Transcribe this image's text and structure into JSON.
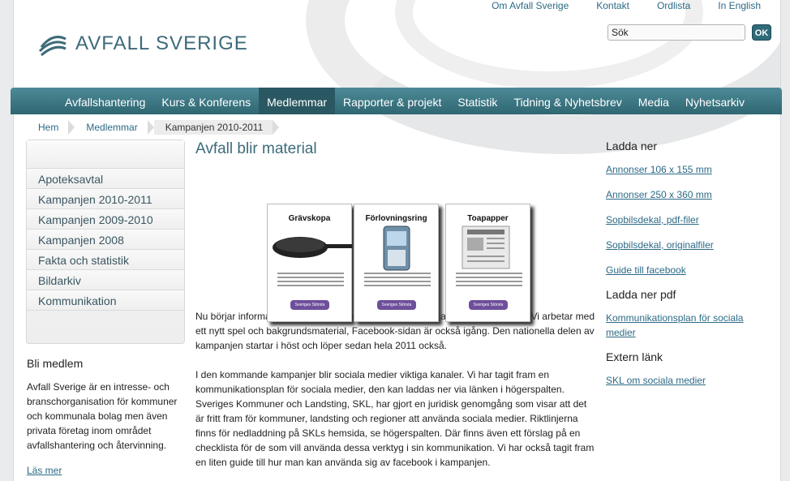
{
  "header": {
    "top_links": [
      "Om Avfall Sverige",
      "Kontakt",
      "Ordlista",
      "In English"
    ],
    "logo_text": "Avfall Sverige",
    "search_placeholder": "Sök",
    "search_button": "OK"
  },
  "nav": {
    "items": [
      "Avfallshantering",
      "Kurs & Konferens",
      "Medlemmar",
      "Rapporter & projekt",
      "Statistik",
      "Tidning & Nyhetsbrev",
      "Media",
      "Nyhetsarkiv"
    ],
    "active": "Medlemmar"
  },
  "breadcrumb": [
    "Hem",
    "Medlemmar",
    "Kampanjen 2010-2011"
  ],
  "sidebar": {
    "items": [
      "Apoteksavtal",
      "Kampanjen 2010-2011",
      "Kampanjen 2009-2010",
      "Kampanjen 2008",
      "Fakta och statistik",
      "Bildarkiv",
      "Kommunikation"
    ],
    "bli_medlem": {
      "title": "Bli medlem",
      "text": "Avfall Sverige är en intresse- och branschorganisation för kommuner och kommunala bolag men även privata företag inom området avfallshantering och återvinning.",
      "link": "Läs mer"
    }
  },
  "main": {
    "title": "Avfall blir material",
    "cards": [
      "Grävskopa",
      "Förlovningsring",
      "Toapapper"
    ],
    "card_badge": "Sveriges Största Miljösamlare",
    "paragraph1": "Nu börjar informationsmaterialet till materialåtervinningskampanjen bli färdigt. Vi arbetar med ett nytt spel och bakgrundsmaterial, Facebook-sidan är också igång. Den nationella delen av kampanjen startar i höst och löper sedan hela 2011 också.",
    "paragraph2": "I den kommande kampanjer blir sociala medier viktiga kanaler. Vi har tagit fram en kommunikationsplan för sociala medier, den kan laddas ner via länken i högerspalten. Sveriges Kommuner och Landsting, SKL, har gjort en juridisk genomgång som visar att det är fritt fram för kommuner, landsting och regioner att använda sociala medier. Riktlinjerna finns för nedladdning på SKLs hemsida, se högerspalten. Där finns även ett förslag på en checklista för de som vill använda dessa verktyg i sin kommunikation. Vi har också tagit fram en liten guide till hur man kan använda sig av facebook i kampanjen."
  },
  "right": {
    "ladda_ner": {
      "title": "Ladda ner",
      "links": [
        "Annonser 106 x 155 mm",
        "Annonser 250 x 360 mm",
        "Sopbilsdekal, pdf-filer",
        "Sopbilsdekal, originalfiler",
        "Guide till facebook"
      ]
    },
    "ladda_ner_pdf": {
      "title": "Ladda ner pdf",
      "links": [
        "Kommunikationsplan för sociala medier"
      ]
    },
    "extern_lank": {
      "title": "Extern länk",
      "links": [
        "SKL om sociala medier"
      ]
    }
  }
}
